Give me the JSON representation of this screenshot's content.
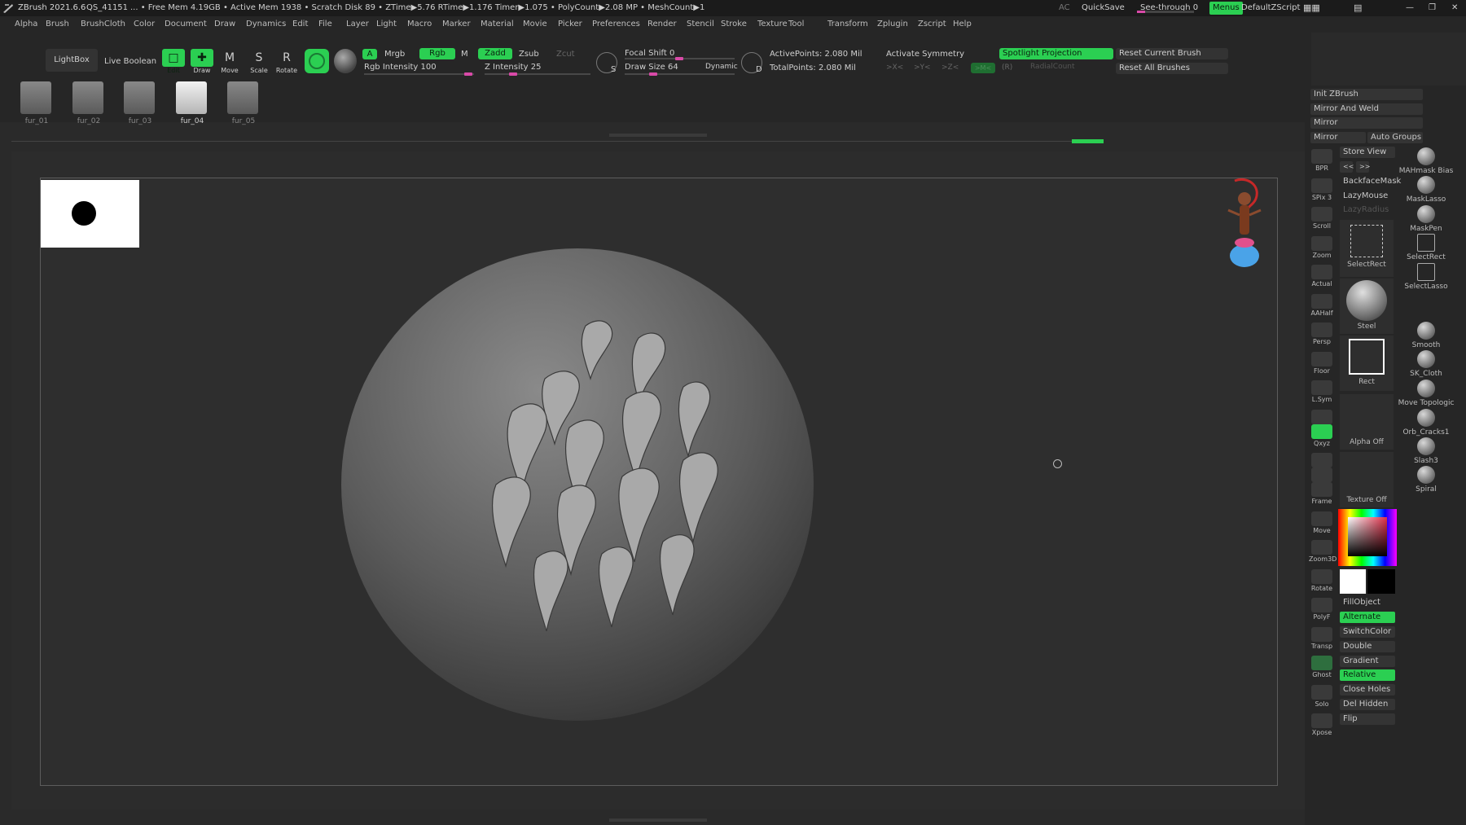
{
  "titlebar": {
    "app": "ZBrush 2021.6.6",
    "session": "QS_41151",
    "stats": "... • Free Mem 4.19GB • Active Mem 1938 • Scratch Disk 89 • ZTime▶5.76 RTime▶1.176 Timer▶1.075 • PolyCount▶2.08 MP • MeshCount▶1",
    "ac": "AC",
    "quicksave": "QuickSave",
    "seethrough": "See-through  0",
    "seethrough_level": 0,
    "menus": "Menus",
    "zscript": "DefaultZScript"
  },
  "menubar": [
    "Alpha",
    "Brush",
    "BrushCloth",
    "Color",
    "Document",
    "Draw",
    "Dynamics",
    "Edit",
    "File",
    "Layer",
    "Light",
    "Macro",
    "Marker",
    "Material",
    "Movie",
    "Picker",
    "Preferences",
    "Render",
    "Stencil",
    "Stroke",
    "Texture",
    "Tool",
    "Transform",
    "Zplugin",
    "Zscript",
    "Help"
  ],
  "toolbar": {
    "lightbox": "LightBox",
    "live_boolean": "Live Boolean",
    "edit": "Edit",
    "draw": "Draw",
    "move": "Move",
    "scale": "Scale",
    "rotate": "Rotate",
    "a": "A",
    "mrgb": "Mrgb",
    "rgb": "Rgb",
    "m": "M",
    "rgb_intensity": "Rgb Intensity 100",
    "zadd": "Zadd",
    "zsub": "Zsub",
    "zcut": "Zcut",
    "z_intensity": "Z Intensity 25",
    "focal_shift": "Focal Shift 0",
    "draw_size": "Draw Size 64",
    "dynamic": "Dynamic",
    "s": "S",
    "d": "D",
    "active_points": "ActivePoints: 2.080 Mil",
    "total_points": "TotalPoints: 2.080 Mil",
    "activate_symmetry": "Activate Symmetry",
    "sym_x": ">X<",
    "sym_y": ">Y<",
    "sym_z": ">Z<",
    "sym_m": ">M<",
    "sym_r": "(R)",
    "spotlight_projection": "Spotlight Projection",
    "radial_count": "RadialCount",
    "reset_current_brush": "Reset Current Brush",
    "reset_all_brushes": "Reset All Brushes"
  },
  "thumbnails": [
    {
      "label": "fur_01"
    },
    {
      "label": "fur_02"
    },
    {
      "label": "fur_03"
    },
    {
      "label": "fur_04"
    },
    {
      "label": "fur_05"
    }
  ],
  "right": {
    "init_zbrush": "Init ZBrush",
    "mirror_and_weld": "Mirror And Weld",
    "mirror": "Mirror",
    "mirror2": "Mirror",
    "auto_groups": "Auto Groups",
    "store_view": "Store View",
    "prev": "<<",
    "next": ">>",
    "backface_mask": "BackfaceMask",
    "lazymouse": "LazyMouse",
    "lazyradius": "LazyRadius",
    "selectrect_slot": "SelectRect",
    "steel": "Steel",
    "rect": "Rect",
    "alpha_off": "Alpha Off",
    "texture_off": "Texture Off",
    "fill_object": "FillObject",
    "alternate": "Alternate",
    "switch_color": "SwitchColor",
    "double": "Double",
    "gradient": "Gradient",
    "relative": "Relative",
    "close_holes": "Close Holes",
    "del_hidden": "Del Hidden",
    "flip": "Flip"
  },
  "vtools": [
    "BPR",
    "SPix 3",
    "Scroll",
    "Zoom",
    "Actual",
    "AAHalf",
    "Persp",
    "Floor",
    "L.Sym",
    "",
    "Qxyz",
    "",
    "",
    "Frame",
    "Move",
    "Zoom3D",
    "Rotate",
    "PolyF",
    "Transp",
    "Ghost",
    "Solo",
    "Xpose"
  ],
  "brushes": [
    "MAHmask Bias",
    "MaskLasso",
    "MaskPen",
    "SelectRect",
    "SelectLasso",
    "Smooth",
    "SK_Cloth",
    "Move Topologic",
    "Orb_Cracks1",
    "Slash3",
    "Spiral"
  ],
  "colors": {
    "accent_green": "#2bcf52",
    "slider_pink": "#d94aa8",
    "bg_dark": "#262626"
  }
}
